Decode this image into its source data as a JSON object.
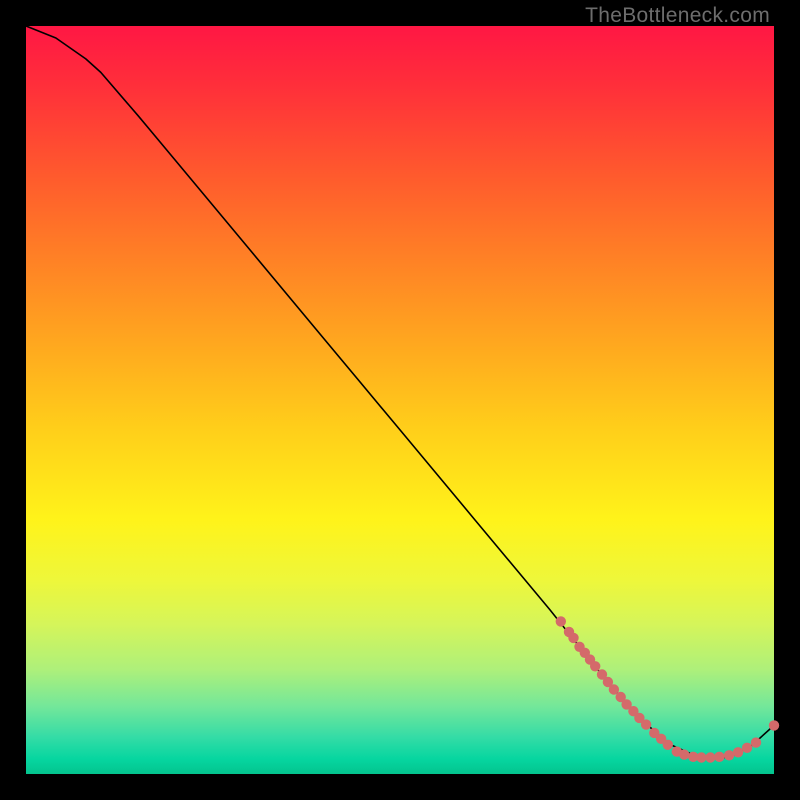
{
  "watermark": "TheBottleneck.com",
  "chart_data": {
    "type": "line",
    "title": "",
    "xlabel": "",
    "ylabel": "",
    "xlim": [
      0,
      100
    ],
    "ylim": [
      0,
      100
    ],
    "grid": false,
    "legend": false,
    "series": [
      {
        "name": "curve",
        "x": [
          0,
          4,
          8,
          10,
          15,
          20,
          30,
          40,
          50,
          60,
          70,
          74,
          78,
          82,
          86,
          90,
          94,
          97,
          100
        ],
        "y": [
          100,
          98.4,
          95.6,
          93.8,
          88.0,
          82.0,
          70.0,
          58.0,
          46.0,
          34.0,
          22.0,
          17.0,
          12.0,
          7.5,
          4.0,
          2.2,
          2.2,
          3.8,
          6.5
        ]
      }
    ],
    "points": {
      "name": "markers",
      "x": [
        71.5,
        72.6,
        73.2,
        74.0,
        74.7,
        75.4,
        76.1,
        77.0,
        77.8,
        78.6,
        79.5,
        80.3,
        81.2,
        82.0,
        82.9,
        84.0,
        84.9,
        85.8,
        87.0,
        88.0,
        89.2,
        90.3,
        91.5,
        92.7,
        94.0,
        95.2,
        96.4,
        97.6,
        100.0
      ],
      "y": [
        20.4,
        19.0,
        18.2,
        17.0,
        16.2,
        15.3,
        14.4,
        13.3,
        12.3,
        11.3,
        10.3,
        9.3,
        8.4,
        7.5,
        6.6,
        5.5,
        4.7,
        3.9,
        3.0,
        2.6,
        2.3,
        2.2,
        2.2,
        2.3,
        2.5,
        2.9,
        3.5,
        4.2,
        6.5
      ]
    }
  }
}
